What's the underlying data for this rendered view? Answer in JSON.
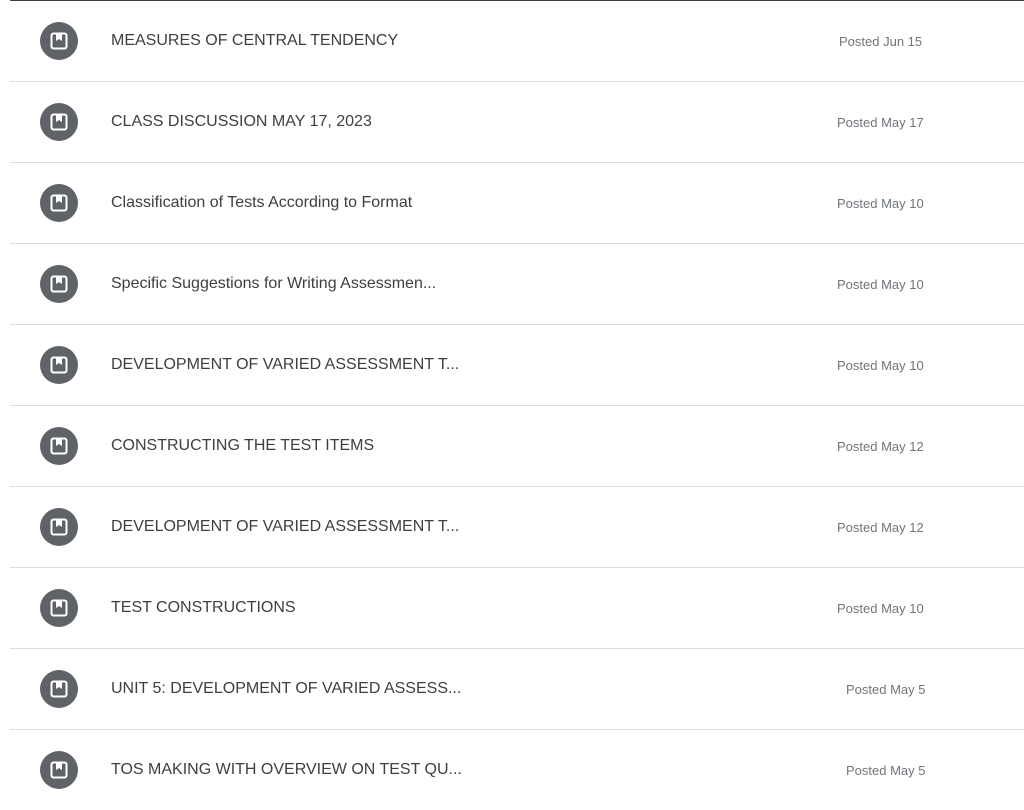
{
  "materials": [
    {
      "title": "MEASURES OF CENTRAL TENDENCY",
      "date": "Posted Jun 15",
      "icon": "material-bookmark-icon"
    },
    {
      "title": "CLASS DISCUSSION MAY 17, 2023",
      "date": "Posted May 17",
      "icon": "material-bookmark-icon"
    },
    {
      "title": "Classification of Tests According to Format",
      "date": "Posted May 10",
      "icon": "material-bookmark-icon"
    },
    {
      "title": "Specific Suggestions for Writing Assessmen...",
      "date": "Posted May 10",
      "icon": "material-bookmark-icon"
    },
    {
      "title": "DEVELOPMENT OF VARIED ASSESSMENT T...",
      "date": "Posted May 10",
      "icon": "material-bookmark-icon"
    },
    {
      "title": "CONSTRUCTING THE TEST ITEMS",
      "date": "Posted May 12",
      "icon": "material-bookmark-icon"
    },
    {
      "title": "DEVELOPMENT OF VARIED ASSESSMENT T...",
      "date": "Posted May 12",
      "icon": "material-bookmark-icon"
    },
    {
      "title": "TEST CONSTRUCTIONS",
      "date": "Posted May 10",
      "icon": "material-bookmark-icon"
    },
    {
      "title": "UNIT 5: DEVELOPMENT OF VARIED ASSESS...",
      "date": "Posted May 5",
      "icon": "material-bookmark-icon"
    },
    {
      "title": "TOS MAKING WITH OVERVIEW ON TEST QU...",
      "date": "Posted May 5",
      "icon": "material-bookmark-icon"
    }
  ],
  "colors": {
    "icon_bg": "#5f6368",
    "title_text": "#3c4043",
    "date_text": "#70757a",
    "divider": "#dadce0"
  }
}
